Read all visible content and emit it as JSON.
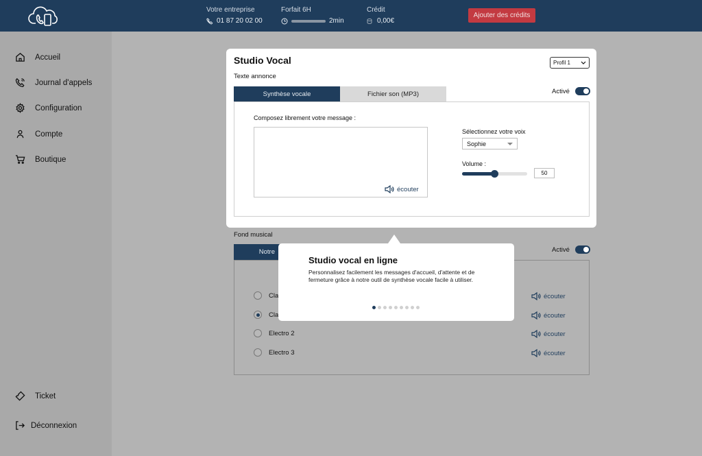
{
  "header": {
    "company_label": "Votre entreprise",
    "company_phone": "01 87 20 02 00",
    "plan_label": "Forfait 6H",
    "plan_usage": "2min",
    "plan_progress": 0.0,
    "credit_label": "Crédit",
    "credit_value": "0,00€",
    "add_credit_label": "Ajouter des crédits",
    "accent_color": "#1f3d5c",
    "cta_color": "#c33a41"
  },
  "sidebar": {
    "items": [
      {
        "label": "Accueil",
        "icon": "home-icon"
      },
      {
        "label": "Journal d'appels",
        "icon": "phone-icon"
      },
      {
        "label": "Configuration",
        "icon": "gear-icon"
      },
      {
        "label": "Compte",
        "icon": "user-icon"
      },
      {
        "label": "Boutique",
        "icon": "cart-icon"
      }
    ],
    "bottom_items": [
      {
        "label": "Ticket",
        "icon": "ticket-icon"
      },
      {
        "label": "Déconnexion",
        "icon": "logout-icon"
      }
    ]
  },
  "studio": {
    "title": "Studio Vocal",
    "profile_selected": "Profil 1",
    "section_label": "Texte annonce",
    "tabs": [
      {
        "label": "Synthèse vocale",
        "active": true
      },
      {
        "label": "Fichier son (MP3)",
        "active": false
      }
    ],
    "toggle_label": "Activé",
    "compose_label": "Composez librement votre message :",
    "textarea_value": "",
    "listen_label": "écouter",
    "voice_label": "Sélectionnez votre voix",
    "voice_selected": "Sophie",
    "volume_label": "Volume :",
    "volume_value": "50",
    "volume_fraction": 0.5
  },
  "music": {
    "section_label": "Fond musical",
    "tab_partial_label": "Notre",
    "toggle_label": "Activé",
    "options": [
      {
        "label": "Cla",
        "checked": false,
        "listen": "écouter"
      },
      {
        "label": "Cla",
        "checked": true,
        "listen": "écouter"
      },
      {
        "label": "Electro 2",
        "checked": false,
        "listen": "écouter"
      },
      {
        "label": "Electro 3",
        "checked": false,
        "listen": "écouter"
      }
    ]
  },
  "tooltip": {
    "title": "Studio vocal en ligne",
    "text": "Personnalisez facilement les messages d'accueil, d'attente et de fermeture grâce à notre outil de synthèse vocale facile à utiliser.",
    "dots_total": 9,
    "dots_active_index": 0
  }
}
